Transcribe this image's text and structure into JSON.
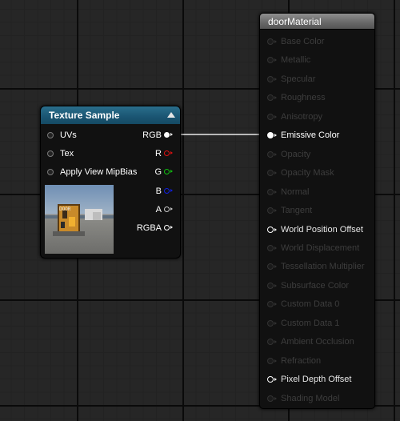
{
  "texture_node": {
    "title": "Texture Sample",
    "inputs": [
      {
        "label": "UVs"
      },
      {
        "label": "Tex"
      },
      {
        "label": "Apply View MipBias"
      }
    ],
    "outputs": [
      {
        "label": "RGB",
        "color": "#ffffff",
        "connected": true
      },
      {
        "label": "R",
        "color": "#e01010",
        "connected": false
      },
      {
        "label": "G",
        "color": "#10c010",
        "connected": false
      },
      {
        "label": "B",
        "color": "#1020e0",
        "connected": false
      },
      {
        "label": "A",
        "color": "#c8c8c8",
        "connected": false
      },
      {
        "label": "RGBA",
        "color": "#ffffff",
        "connected": false
      }
    ],
    "preview_text": "DOOR"
  },
  "material_node": {
    "title": "doorMaterial",
    "pins": [
      {
        "label": "Base Color",
        "state": "disabled"
      },
      {
        "label": "Metallic",
        "state": "disabled"
      },
      {
        "label": "Specular",
        "state": "disabled"
      },
      {
        "label": "Roughness",
        "state": "disabled"
      },
      {
        "label": "Anisotropy",
        "state": "disabled"
      },
      {
        "label": "Emissive Color",
        "state": "connected"
      },
      {
        "label": "Opacity",
        "state": "disabled"
      },
      {
        "label": "Opacity Mask",
        "state": "disabled"
      },
      {
        "label": "Normal",
        "state": "disabled"
      },
      {
        "label": "Tangent",
        "state": "disabled"
      },
      {
        "label": "World Position Offset",
        "state": "enabled"
      },
      {
        "label": "World Displacement",
        "state": "disabled"
      },
      {
        "label": "Tessellation Multiplier",
        "state": "disabled"
      },
      {
        "label": "Subsurface Color",
        "state": "disabled"
      },
      {
        "label": "Custom Data 0",
        "state": "disabled"
      },
      {
        "label": "Custom Data 1",
        "state": "disabled"
      },
      {
        "label": "Ambient Occlusion",
        "state": "disabled"
      },
      {
        "label": "Refraction",
        "state": "disabled"
      },
      {
        "label": "Pixel Depth Offset",
        "state": "enabled"
      },
      {
        "label": "Shading Model",
        "state": "disabled"
      }
    ]
  },
  "connection": {
    "from": "RGB",
    "to": "Emissive Color"
  }
}
